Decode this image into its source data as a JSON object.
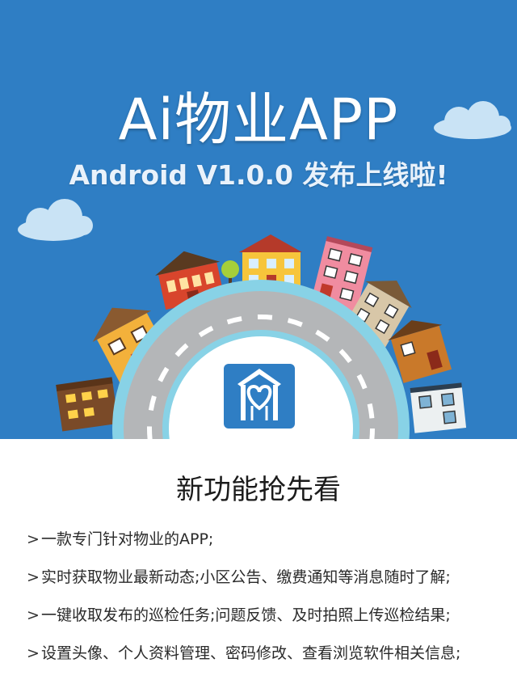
{
  "hero": {
    "title": "Ai物业APP",
    "subtitle": "Android V1.0.0 发布上线啦!"
  },
  "section_title": "新功能抢先看",
  "features": [
    {
      "bullet": ">",
      "text": "一款专门针对物业的APP;"
    },
    {
      "bullet": ">",
      "text": "实时获取物业最新动态;小区公告、缴费通知等消息随时了解;"
    },
    {
      "bullet": ">",
      "text": "一键收取发布的巡检任务;问题反馈、及时拍照上传巡检结果;"
    },
    {
      "bullet": ">",
      "text": "设置头像、个人资料管理、密码修改、查看浏览软件相关信息;"
    }
  ],
  "colors": {
    "sky": "#2f7ec4",
    "cloud": "#c9e3f5",
    "road": "#b4b6b8",
    "road_edge": "#88d2e6",
    "app_icon": "#2f7ec4"
  },
  "icons": [
    "cloud-icon",
    "house-icon",
    "app-logo-icon",
    "tree-icon",
    "street-lamp-icon",
    "chevron-right-icon"
  ]
}
